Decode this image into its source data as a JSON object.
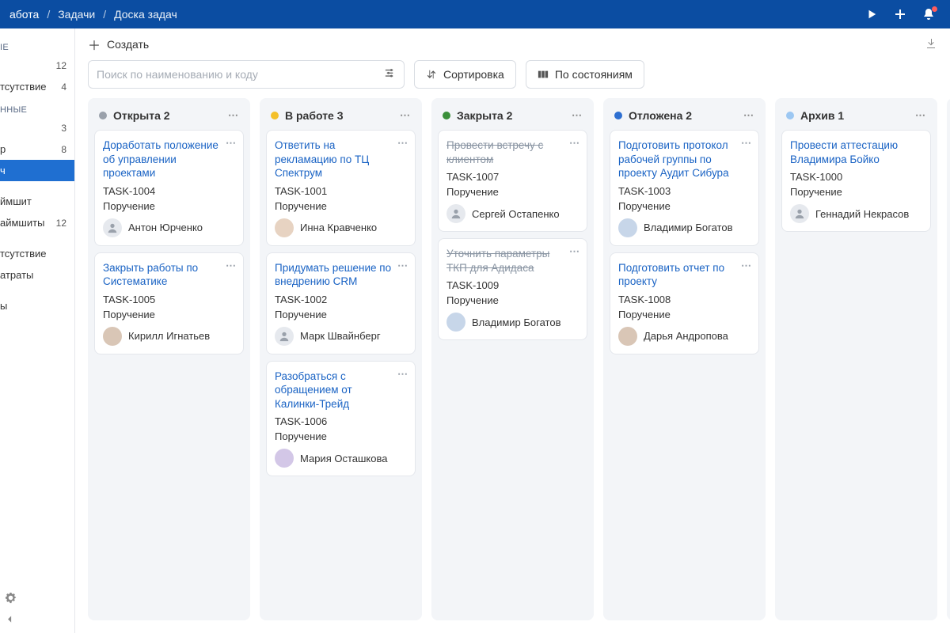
{
  "topbar": {
    "app": "абота",
    "breadcrumb": [
      "Задачи",
      "Доска задач"
    ]
  },
  "sidebar": {
    "sectionTop": "ІЕ",
    "top": [
      {
        "label": "",
        "count": "12"
      },
      {
        "label": "тсутствие",
        "count": "4"
      }
    ],
    "section": "ННЫЕ",
    "items": [
      {
        "label": "",
        "count": "3"
      },
      {
        "label": "р",
        "count": "8"
      },
      {
        "label": "ч",
        "count": "",
        "active": true
      },
      {
        "label": "",
        "count": ""
      },
      {
        "label": "ймшит",
        "count": ""
      },
      {
        "label": "аймшиты",
        "count": "12"
      },
      {
        "label": "",
        "count": ""
      },
      {
        "label": "тсутствие",
        "count": ""
      },
      {
        "label": "атраты",
        "count": ""
      },
      {
        "label": "",
        "count": ""
      },
      {
        "label": "ы",
        "count": ""
      }
    ]
  },
  "toolbar": {
    "create": "Создать"
  },
  "filter": {
    "placeholder": "Поиск по наименованию и коду",
    "sort": "Сортировка",
    "state": "По состояниям"
  },
  "statusColors": {
    "open": "#9aa1ab",
    "progress": "#f4c02a",
    "closed": "#3a8f3a",
    "deferred": "#2e6fd1",
    "archive": "#9cc7f2"
  },
  "columns": [
    {
      "title": "Открыта 2",
      "colorKey": "open",
      "cards": [
        {
          "title": "Доработать положение об управлении проектами",
          "code": "TASK-1004",
          "type": "Поручение",
          "assignee": "Антон Юрченко",
          "avatar": "empty"
        },
        {
          "title": "Закрыть работы по Систематике",
          "code": "TASK-1005",
          "type": "Поручение",
          "assignee": "Кирилл Игнатьев",
          "avatar": "person"
        }
      ]
    },
    {
      "title": "В работе 3",
      "colorKey": "progress",
      "cards": [
        {
          "title": "Ответить на рекламацию по ТЦ Спектрум",
          "code": "TASK-1001",
          "type": "Поручение",
          "assignee": "Инна Кравченко",
          "avatar": "p3"
        },
        {
          "title": "Придумать решение по внедрению CRM",
          "code": "TASK-1002",
          "type": "Поручение",
          "assignee": "Марк Швайнберг",
          "avatar": "empty"
        },
        {
          "title": "Разобраться с обращением от Калинки-Трейд",
          "code": "TASK-1006",
          "type": "Поручение",
          "assignee": "Мария Осташкова",
          "avatar": "p4"
        }
      ]
    },
    {
      "title": "Закрыта 2",
      "colorKey": "closed",
      "cards": [
        {
          "title": "Провести встречу с клиентом",
          "strike": true,
          "code": "TASK-1007",
          "type": "Поручение",
          "assignee": "Сергей Остапенко",
          "avatar": "empty"
        },
        {
          "title": "Уточнить параметры ТКП для Адидаса",
          "strike": true,
          "code": "TASK-1009",
          "type": "Поручение",
          "assignee": "Владимир Богатов",
          "avatar": "p2"
        }
      ]
    },
    {
      "title": "Отложена 2",
      "colorKey": "deferred",
      "cards": [
        {
          "title": "Подготовить протокол рабочей группы по проекту Аудит Сибура",
          "code": "TASK-1003",
          "type": "Поручение",
          "assignee": "Владимир Богатов",
          "avatar": "p2"
        },
        {
          "title": "Подготовить отчет по проекту",
          "code": "TASK-1008",
          "type": "Поручение",
          "assignee": "Дарья Андропова",
          "avatar": "person"
        }
      ]
    },
    {
      "title": "Архив 1",
      "colorKey": "archive",
      "cards": [
        {
          "title": "Провести аттестацию Владимира Бойко",
          "code": "TASK-1000",
          "type": "Поручение",
          "assignee": "Геннадий Некрасов",
          "avatar": "empty",
          "nomenu": true
        }
      ]
    }
  ]
}
